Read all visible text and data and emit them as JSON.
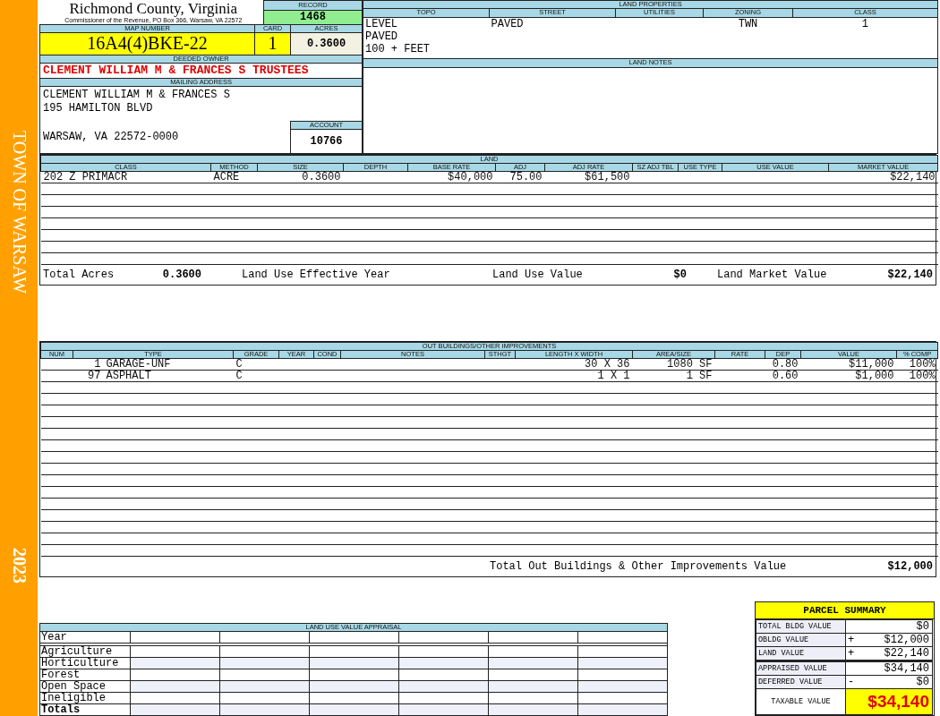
{
  "sidebar": {
    "title": "TOWN OF WARSAW",
    "year": "2023"
  },
  "header": {
    "county": "Richmond County, Virginia",
    "subtitle": "Commissioner of the Revenue, PO Box 366, Warsaw, VA 22572"
  },
  "record": {
    "label": "RECORD",
    "value": "1468"
  },
  "map_number": {
    "label": "MAP NUMBER",
    "value": "16A4(4)BKE-22"
  },
  "card": {
    "label": "CARD",
    "value": "1"
  },
  "acres": {
    "label": "ACRES",
    "value": "0.3600"
  },
  "deeded_owner": {
    "label": "DEEDED OWNER",
    "value": "CLEMENT WILLIAM M & FRANCES S TRUSTEES"
  },
  "mailing_address": {
    "label": "MAILING ADDRESS",
    "street_lines": [
      "CLEMENT WILLIAM M & FRANCES S",
      "195 HAMILTON BLVD"
    ],
    "city_line": "WARSAW, VA 22572-0000"
  },
  "account": {
    "label": "ACCOUNT",
    "value": "10766"
  },
  "land_properties": {
    "title": "LAND PROPERTIES",
    "columns": [
      {
        "label": "TOPO",
        "values": [
          "LEVEL",
          "PAVED",
          "100 + FEET"
        ]
      },
      {
        "label": "STREET",
        "values": [
          "PAVED"
        ]
      },
      {
        "label": "UTILITIES"
      },
      {
        "label": "ZONING",
        "values": [
          "TWN"
        ]
      },
      {
        "label": "CLASS",
        "values": [
          "1"
        ]
      }
    ]
  },
  "land_notes": {
    "title": "LAND NOTES"
  },
  "land": {
    "title": "LAND",
    "columns": [
      "CLASS",
      "METHOD",
      "SIZE",
      "DEPTH",
      "BASE RATE",
      "ADJ",
      "ADJ RATE",
      "SZ ADJ TBL",
      "USE TYPE",
      "USE VALUE",
      "MARKET VALUE"
    ],
    "rows": [
      {
        "class": "202 Z PRIMACR",
        "method": "ACRE",
        "size": "0.3600",
        "base_rate": "$40,000",
        "adj": "75.00",
        "adj_rate": "$61,500",
        "market_value": "$22,140"
      }
    ],
    "totals": {
      "total_acres_label": "Total Acres",
      "total_acres": "0.3600",
      "effective_year_label": "Land Use Effective Year",
      "use_value_label": "Land Use Value",
      "use_value": "$0",
      "market_value_label": "Land Market Value",
      "market_value": "$22,140"
    }
  },
  "outbuildings": {
    "title": "OUT BUILDINGS/OTHER IMPROVEMENTS",
    "columns": [
      "NUM",
      "TYPE",
      "GRADE",
      "YEAR",
      "COND",
      "NOTES",
      "STHGT",
      "LENGTH X WIDTH",
      "AREA/SIZE",
      "RATE",
      "DEP",
      "VALUE",
      "% COMP"
    ],
    "rows": [
      {
        "type_code": "1",
        "type": "GARAGE-UNF",
        "grade": "C",
        "length_width": "30 X 36",
        "area": "1080 SF",
        "dep": "0.80",
        "value": "$11,000",
        "comp": "100%"
      },
      {
        "type_code": "97",
        "type": "ASPHALT",
        "grade": "C",
        "length_width": "1 X 1",
        "area": "1 SF",
        "dep": "0.60",
        "value": "$1,000",
        "comp": "100%"
      }
    ],
    "total_label": "Total Out Buildings & Other Improvements Value",
    "total_value": "$12,000"
  },
  "land_use_appraisal": {
    "title": "LAND USE VALUE APPRAISAL",
    "rows": [
      {
        "label": "Year",
        "kind": "header"
      },
      {
        "label": "Agriculture",
        "kind": "category"
      },
      {
        "label": "Horticulture",
        "kind": "category"
      },
      {
        "label": "Forest",
        "kind": "category"
      },
      {
        "label": "Open Space",
        "kind": "category"
      },
      {
        "label": "Ineligible",
        "kind": "category"
      },
      {
        "label": "Totals",
        "kind": "total"
      }
    ]
  },
  "parcel_summary": {
    "title": "PARCEL SUMMARY",
    "rows": [
      {
        "label": "TOTAL BLDG VALUE",
        "value": "$0",
        "kind": "value"
      },
      {
        "label": "OBLDG VALUE",
        "sign": "+",
        "value": "$12,000",
        "kind": "value"
      },
      {
        "label": "LAND VALUE",
        "sign": "+",
        "value": "$22,140",
        "kind": "value"
      },
      {
        "label": "APPRAISED VALUE",
        "value": "$34,140",
        "kind": "total"
      },
      {
        "label": "DEFERRED VALUE",
        "sign": "-",
        "value": "$0",
        "kind": "value"
      }
    ],
    "taxable": {
      "label": "TAXABLE VALUE",
      "value": "$34,140"
    }
  }
}
